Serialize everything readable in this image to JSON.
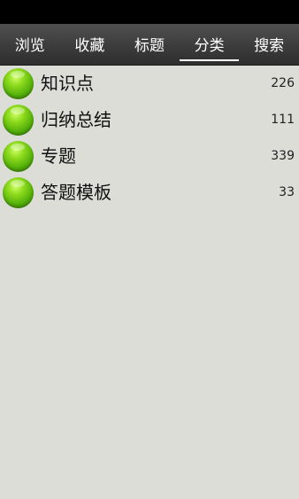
{
  "tabs": [
    {
      "label": "浏览",
      "active": false
    },
    {
      "label": "收藏",
      "active": false
    },
    {
      "label": "标题",
      "active": false
    },
    {
      "label": "分类",
      "active": true
    },
    {
      "label": "搜索",
      "active": false
    }
  ],
  "categories": [
    {
      "label": "知识点",
      "count": "226",
      "icon": "green-ball-icon"
    },
    {
      "label": "归纳总结",
      "count": "111",
      "icon": "green-ball-icon"
    },
    {
      "label": "专题",
      "count": "339",
      "icon": "green-ball-icon"
    },
    {
      "label": "答题模板",
      "count": "33",
      "icon": "green-ball-icon"
    }
  ],
  "colors": {
    "status_bar": "#000000",
    "tab_bar": "#3c3c3c",
    "background": "#dcddd6",
    "accent": "#6cc514"
  }
}
